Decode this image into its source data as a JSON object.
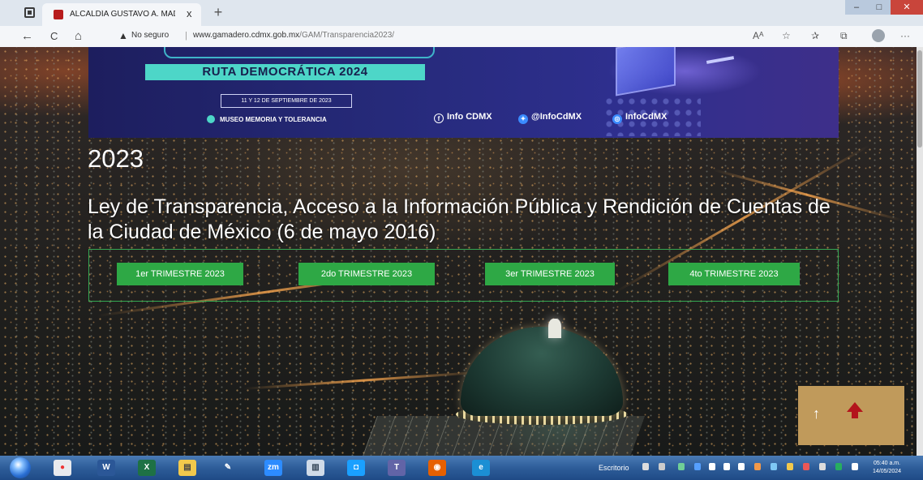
{
  "browser": {
    "tab_title": "ALCALDÍA GUSTAVO A. MADERO",
    "tab_close": "x",
    "new_tab": "+",
    "security_label": "No seguro",
    "url_domain": "www.gamadero.cdmx.gob.mx",
    "url_path": "/GAM/Transparencia2023/",
    "nav": {
      "back": "←",
      "reload": "C",
      "home": "⌂"
    }
  },
  "banner": {
    "event_title": "RUTA DEMOCRÁTICA 2024",
    "dates": "11 Y 12 DE SEPTIEMBRE DE 2023",
    "venue": "MUSEO MEMORIA Y TOLERANCIA",
    "social": [
      {
        "icon": "facebook-icon",
        "label": "Info CDMX"
      },
      {
        "icon": "twitter-icon",
        "label": "@InfoCdMX"
      },
      {
        "icon": "instagram-icon",
        "label": "InfoCdMX"
      }
    ]
  },
  "content": {
    "year": "2023",
    "law_title": "Ley de Transparencia, Acceso a la Información Pública y Rendición de Cuentas de la Ciudad de México (6 de mayo 2016)",
    "quarters": [
      "1er TRIMESTRE 2023",
      "2do TRIMESTRE 2023",
      "3er TRIMESTRE 2023",
      "4to TRIMESTRE 2023"
    ]
  },
  "to_top": {
    "arrow": "↑"
  },
  "taskbar": {
    "search_label": "Escritorio",
    "time": "05:40 a.m.",
    "date": "14/05/2024"
  },
  "colors": {
    "banner_bg": "#262a7a",
    "accent_teal": "#4dd6c8",
    "quarter_button": "#2ea845",
    "to_top_bg": "#c09a5b"
  }
}
